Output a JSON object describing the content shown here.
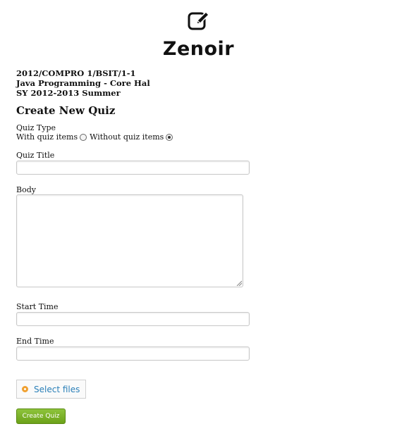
{
  "brand": {
    "name": "Zenoir",
    "icon": "edit-icon"
  },
  "course": {
    "line1": "2012/COMPRO 1/BSIT/1-1",
    "line2": "Java Programming - Core Hal",
    "line3": "SY 2012-2013 Summer"
  },
  "form": {
    "heading": "Create New Quiz",
    "quiz_type_label": "Quiz Type",
    "option_with": "With quiz items",
    "option_without": "Without quiz items",
    "selected_option": "Without quiz items",
    "quiz_title_label": "Quiz Title",
    "quiz_title_value": "",
    "body_label": "Body",
    "body_value": "",
    "start_time_label": "Start Time",
    "start_time_value": "",
    "end_time_label": "End Time",
    "end_time_value": "",
    "select_files_label": "Select files",
    "submit_label": "Create Quiz"
  },
  "colors": {
    "accent_green": "#6ca219",
    "link_blue": "#2a7fb8",
    "upload_icon_orange": "#f0a030"
  }
}
